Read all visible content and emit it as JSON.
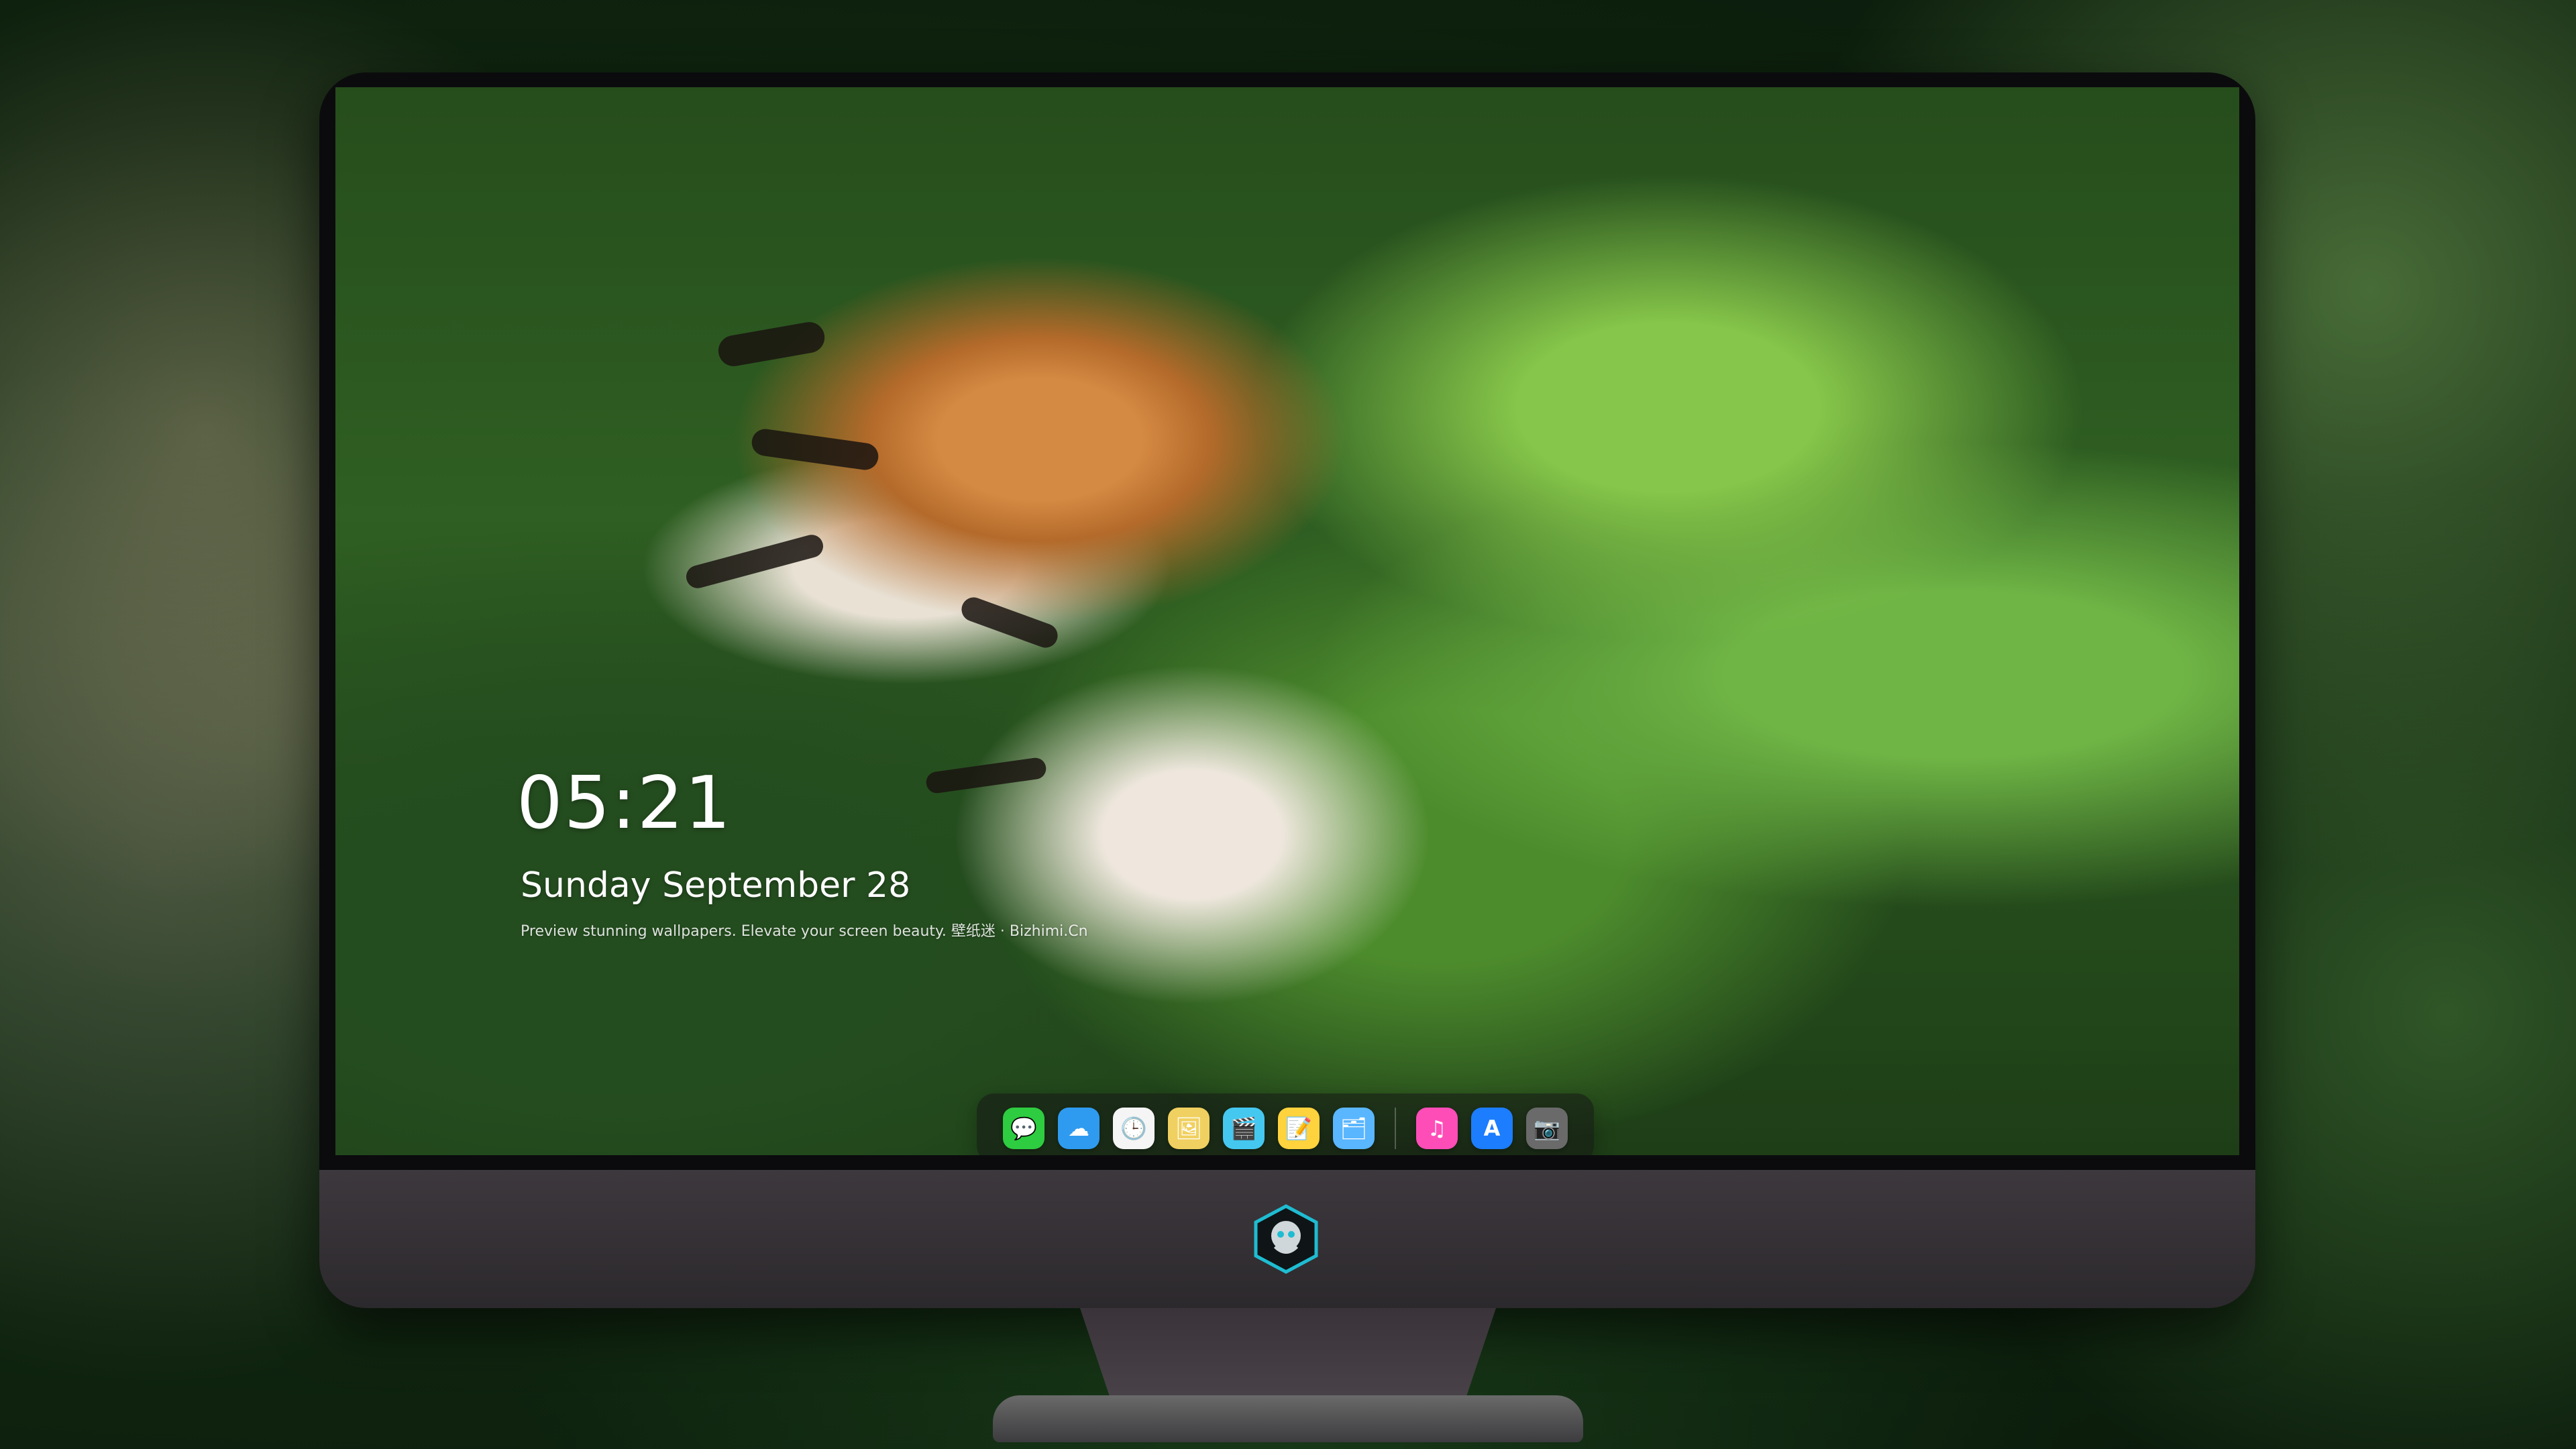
{
  "lockscreen": {
    "time": "05:21",
    "date": "Sunday September  28",
    "note": "Preview stunning wallpapers. Elevate your screen beauty. 壁纸迷 · Bizhimi.Cn"
  },
  "dock": {
    "apps": [
      {
        "name": "messages-icon",
        "glyph": "💬",
        "color": "#2ecc40"
      },
      {
        "name": "weather-icon",
        "glyph": "☁",
        "color": "#2f9bf0"
      },
      {
        "name": "clock-icon",
        "glyph": "🕒",
        "color": "#f5f5f5"
      },
      {
        "name": "preview-icon",
        "glyph": "🖼",
        "color": "#f0d060"
      },
      {
        "name": "clips-icon",
        "glyph": "🎬",
        "color": "#45c8f0"
      },
      {
        "name": "notes-icon",
        "glyph": "📝",
        "color": "#ffd33d"
      },
      {
        "name": "photos-icon",
        "glyph": "🗂",
        "color": "#5ab6ff"
      },
      {
        "name": "music-icon",
        "glyph": "♫",
        "color": "#ff4db8"
      },
      {
        "name": "app-store-icon",
        "glyph": "A",
        "color": "#1c7dff"
      },
      {
        "name": "camera-icon",
        "glyph": "📷",
        "color": "#6a6a6a"
      }
    ]
  },
  "brand": {
    "color": "#1fbcd1"
  }
}
